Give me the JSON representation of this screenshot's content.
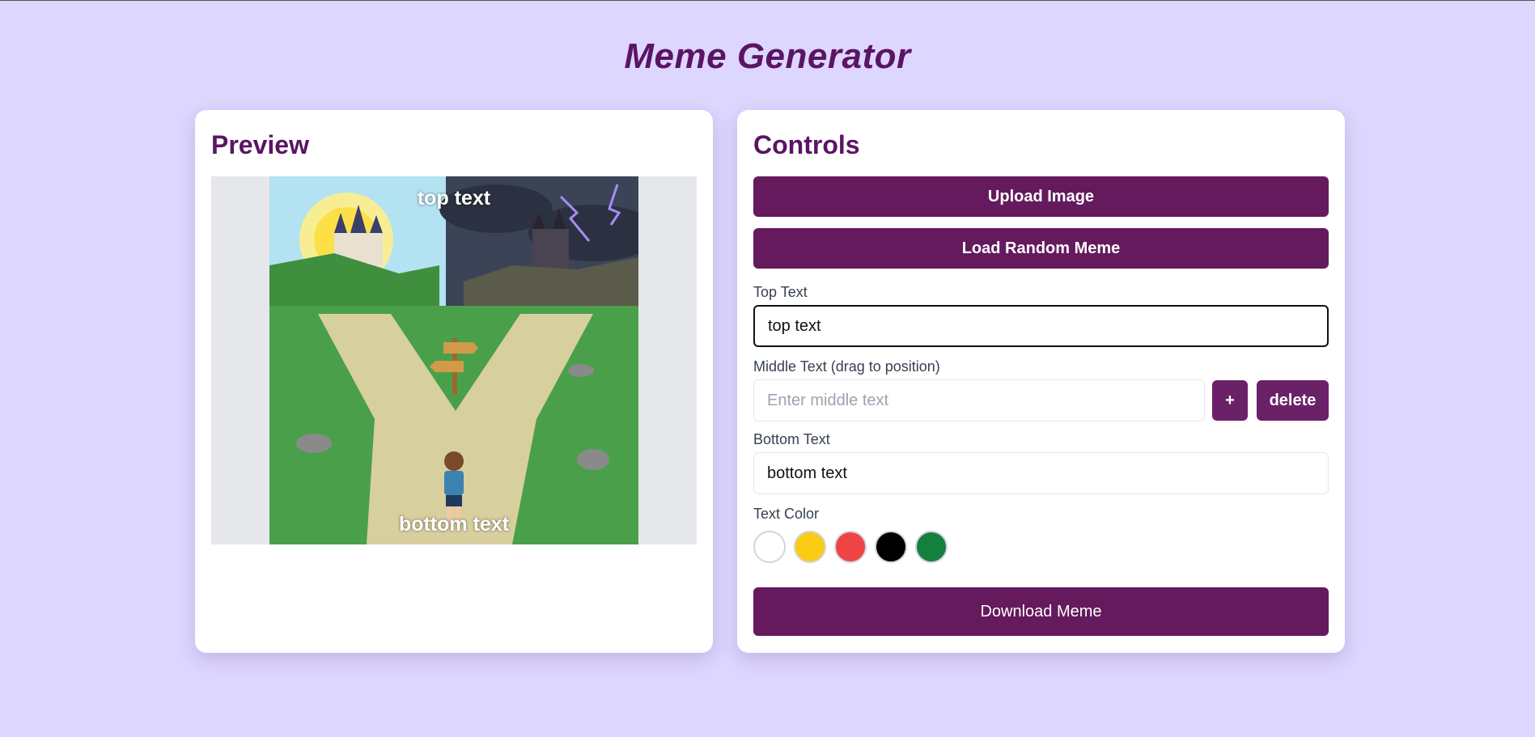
{
  "app": {
    "title": "Meme Generator"
  },
  "preview": {
    "heading": "Preview",
    "top_text": "top text",
    "bottom_text": "bottom text"
  },
  "controls": {
    "heading": "Controls",
    "upload_label": "Upload Image",
    "random_label": "Load Random Meme",
    "top_text_label": "Top Text",
    "top_text_value": "top text",
    "middle_text_label": "Middle Text (drag to position)",
    "middle_text_placeholder": "Enter middle text",
    "add_label": "+",
    "delete_label": "delete",
    "bottom_text_label": "Bottom Text",
    "bottom_text_value": "bottom text",
    "text_color_label": "Text Color",
    "colors": [
      "#ffffff",
      "#facc15",
      "#ef4444",
      "#000000",
      "#15803d"
    ],
    "download_label": "Download Meme"
  }
}
